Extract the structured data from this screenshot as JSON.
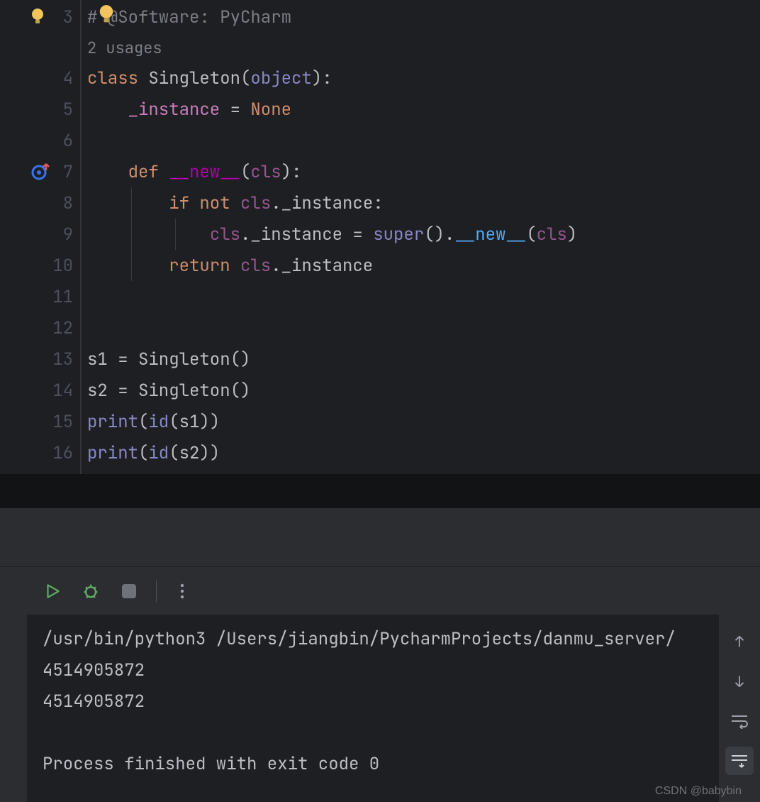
{
  "editor": {
    "lines": [
      {
        "num": 3,
        "usage": false
      },
      {
        "num": null,
        "usage": true
      },
      {
        "num": 4,
        "usage": false
      },
      {
        "num": 5,
        "usage": false
      },
      {
        "num": 6,
        "usage": false
      },
      {
        "num": 7,
        "usage": false,
        "override": true
      },
      {
        "num": 8,
        "usage": false
      },
      {
        "num": 9,
        "usage": false
      },
      {
        "num": 10,
        "usage": false
      },
      {
        "num": 11,
        "usage": false
      },
      {
        "num": 12,
        "usage": false
      },
      {
        "num": 13,
        "usage": false
      },
      {
        "num": 14,
        "usage": false
      },
      {
        "num": 15,
        "usage": false
      },
      {
        "num": 16,
        "usage": false
      }
    ],
    "code": {
      "l3_comment_prefix": "# @Software",
      "l3_comment_suffix": ": PyCharm",
      "usage_label": "2 usages",
      "l4_class": "class ",
      "l4_name": "Singleton",
      "l4_p1": "(",
      "l4_obj": "object",
      "l4_p2": "):",
      "l5_field": "    _instance",
      "l5_eq": " = ",
      "l5_none": "None",
      "l7_def": "    def ",
      "l7_name": "__new__",
      "l7_p1": "(",
      "l7_cls": "cls",
      "l7_p2": "):",
      "l8_if": "        if ",
      "l8_not": "not ",
      "l8_cls": "cls",
      "l8_rest": "._instance:",
      "l9_pre": "            ",
      "l9_cls1": "cls",
      "l9_mid": "._instance = ",
      "l9_super": "super",
      "l9_p": "().",
      "l9_new": "__new__",
      "l9_p2": "(",
      "l9_cls2": "cls",
      "l9_p3": ")",
      "l10_ret": "        return ",
      "l10_cls": "cls",
      "l10_rest": "._instance",
      "l13_s1": "s1 = Singleton()",
      "l14_s2": "s2 = Singleton()",
      "l15_print": "print",
      "l15_p1": "(",
      "l15_id": "id",
      "l15_p2": "(s1))",
      "l16_print": "print",
      "l16_p1": "(",
      "l16_id": "id",
      "l16_p2": "(s2))"
    }
  },
  "console": {
    "cmd": "/usr/bin/python3 /Users/jiangbin/PycharmProjects/danmu_server/",
    "out1": "4514905872",
    "out2": "4514905872",
    "exit": "Process finished with exit code 0"
  },
  "watermark": "CSDN @babybin"
}
